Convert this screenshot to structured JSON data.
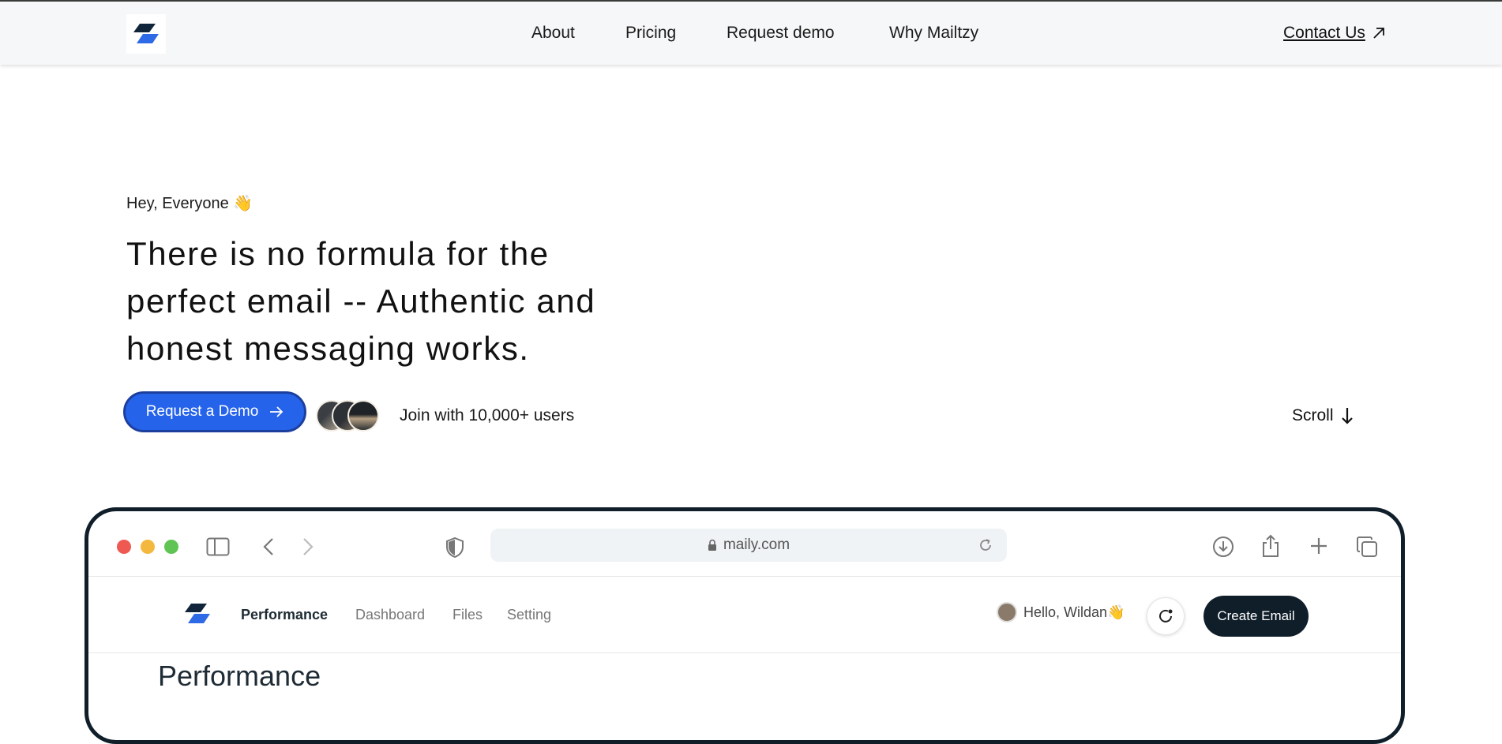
{
  "header": {
    "nav": [
      "About",
      "Pricing",
      "Request demo",
      "Why Mailtzy"
    ],
    "contact_label": "Contact Us"
  },
  "hero": {
    "greeting": "Hey, Everyone 👋",
    "headline_lines": [
      "There is no formula for the",
      "perfect email -- Authentic and",
      "honest messaging works."
    ],
    "cta_label": "Request a Demo",
    "join_text": "Join with 10,000+ users",
    "scroll_label": "Scroll"
  },
  "mockup": {
    "url": "maily.com",
    "nav": [
      "Performance",
      "Dashboard",
      "Files",
      "Setting"
    ],
    "greeting": "Hello, Wildan👋",
    "create_label": "Create Email",
    "page_title": "Performance"
  },
  "colors": {
    "accent": "#2563eb",
    "dark": "#0f1e29",
    "logo_dark": "#10243a",
    "logo_blue": "#2f6ae6"
  }
}
